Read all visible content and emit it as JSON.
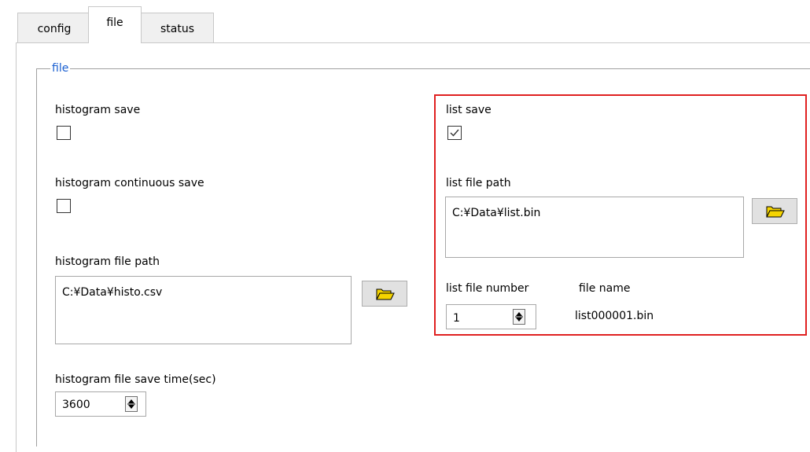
{
  "tabs": {
    "config": "config",
    "file": "file",
    "status": "status"
  },
  "group": {
    "title": "file"
  },
  "histogram": {
    "save_label": "histogram save",
    "save_checked": false,
    "continuous_label": "histogram continuous save",
    "continuous_checked": false,
    "path_label": "histogram file path",
    "path_value": "C:¥Data¥histo.csv",
    "save_time_label": "histogram file save time(sec)",
    "save_time_value": "3600"
  },
  "list": {
    "save_label": "list save",
    "save_checked": true,
    "path_label": "list file path",
    "path_value": "C:¥Data¥list.bin",
    "number_label": "list file number",
    "number_value": "1",
    "file_name_label": "file name",
    "file_name_value": "list000001.bin"
  },
  "icons": {
    "browse": "folder-open-icon",
    "spin": "spin-up-down-icon",
    "check": "checkmark-icon"
  },
  "colors": {
    "highlight": "#e02020",
    "legend": "#1a5fd1",
    "folder": "#f5d400"
  }
}
